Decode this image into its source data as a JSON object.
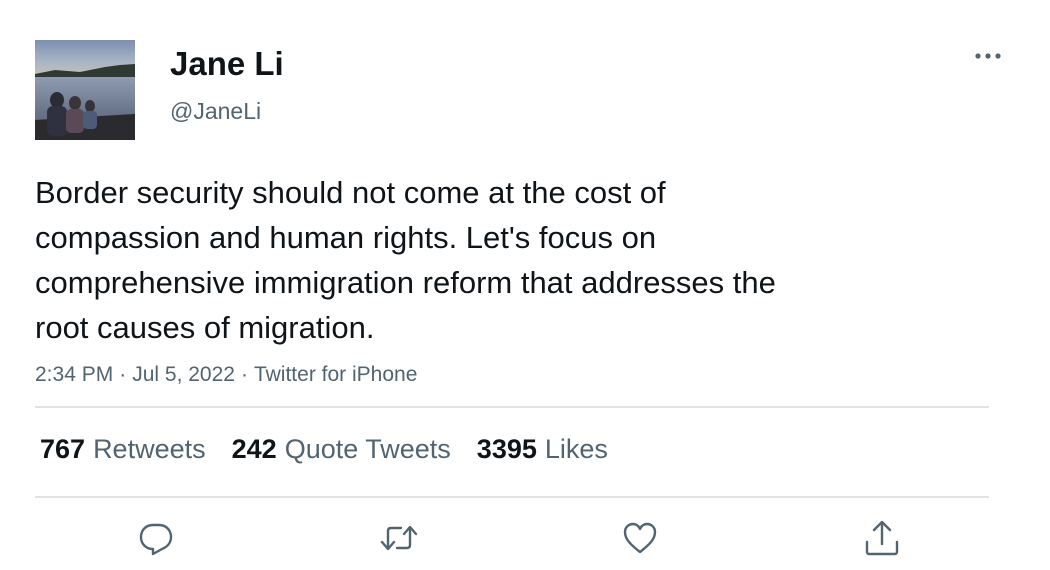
{
  "author": {
    "display_name": "Jane Li",
    "handle": "@JaneLi"
  },
  "tweet": {
    "text": "Border security should not come at the cost of\ncompassion and human rights. Let's focus on\ncomprehensive immigration reform that addresses the\nroot causes of migration.",
    "time": "2:34 PM",
    "date": "Jul 5, 2022",
    "source": "Twitter for iPhone",
    "separator": "·"
  },
  "stats": {
    "retweets_count": "767",
    "retweets_label": "Retweets",
    "quotes_count": "242",
    "quotes_label": "Quote Tweets",
    "likes_count": "3395",
    "likes_label": "Likes"
  },
  "colors": {
    "primary_text": "#0f1419",
    "secondary_text": "#536471",
    "divider": "#e1e4e7"
  },
  "icons": {
    "more": "more-horizontal-icon",
    "reply": "reply-icon",
    "retweet": "retweet-icon",
    "like": "like-icon",
    "share": "share-icon"
  }
}
